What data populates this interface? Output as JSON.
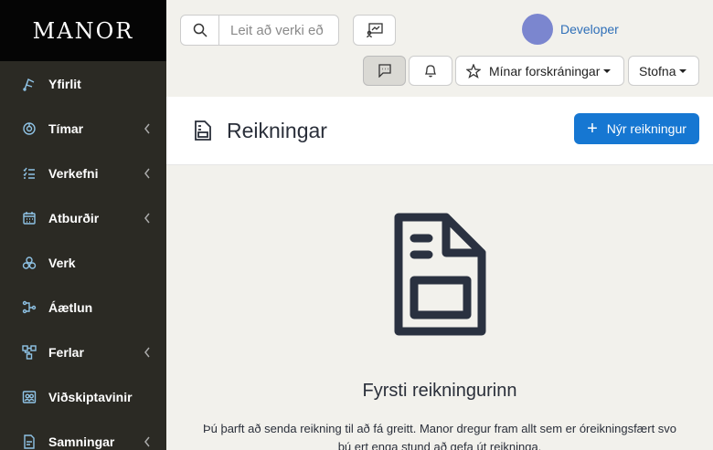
{
  "brand": "MANOR",
  "sidebar": {
    "items": [
      {
        "label": "Yfirlit",
        "icon": "overview-icon",
        "has_submenu": false
      },
      {
        "label": "Tímar",
        "icon": "time-icon",
        "has_submenu": true
      },
      {
        "label": "Verkefni",
        "icon": "tasks-icon",
        "has_submenu": true
      },
      {
        "label": "Atburðir",
        "icon": "calendar-icon",
        "has_submenu": true
      },
      {
        "label": "Verk",
        "icon": "projects-icon",
        "has_submenu": false
      },
      {
        "label": "Áætlun",
        "icon": "plan-icon",
        "has_submenu": false
      },
      {
        "label": "Ferlar",
        "icon": "workflow-icon",
        "has_submenu": true
      },
      {
        "label": "Viðskiptavinir",
        "icon": "customers-icon",
        "has_submenu": false
      },
      {
        "label": "Samningar",
        "icon": "contract-icon",
        "has_submenu": true
      }
    ]
  },
  "topbar": {
    "search_placeholder": "Leit að verki eð",
    "user_name": "Developer",
    "favorites_label": "Mínar forskráningar",
    "create_label": "Stofna"
  },
  "page": {
    "title": "Reikningar",
    "new_button_label": "Nýr reikningur"
  },
  "empty_state": {
    "title": "Fyrsti reikningurinn",
    "line1": "Þú þarft að senda reikning til að fá greitt. Manor dregur fram allt sem er óreikningsfært svo",
    "line2": "þú ert enga stund að gefa út reikninga."
  },
  "colors": {
    "sidebar_bg": "#2b2a24",
    "brand_bg": "#050505",
    "accent": "#1677d2",
    "avatar": "#7b86cf",
    "link": "#2f6fb8",
    "nav_icon": "#8fc3e6"
  }
}
